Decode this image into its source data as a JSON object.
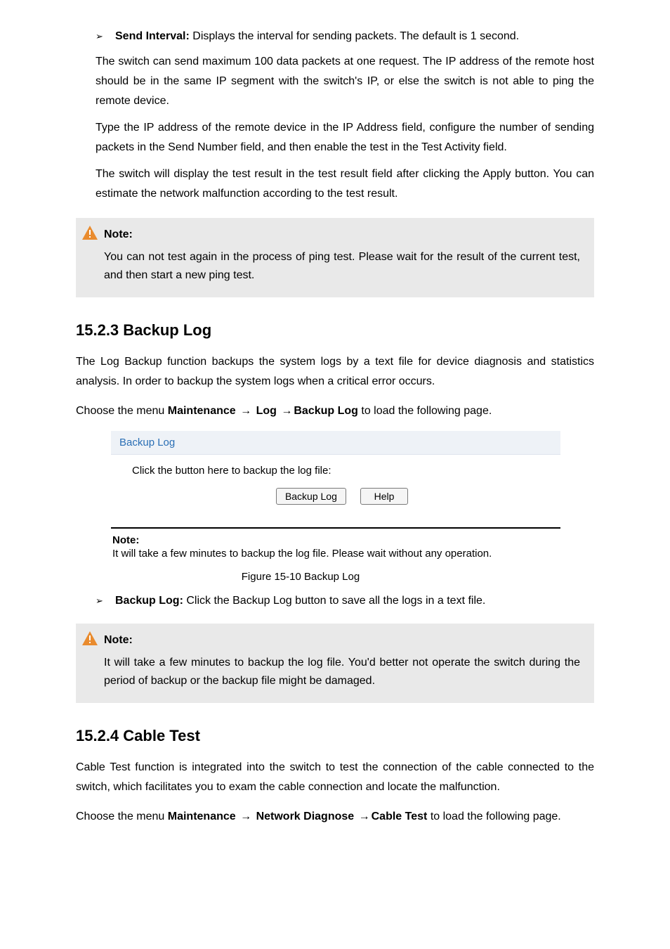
{
  "bullets": {
    "send_interval": {
      "label": "Send Interval:",
      "text": " Displays the interval for sending packets. The default is 1 second."
    },
    "backup_btn": {
      "label": "Backup Log:",
      "text": " Click the Backup Log button to save all the logs in a text file."
    }
  },
  "paras": {
    "p1": "The switch can send maximum 100 data packets at one request. The IP address of the remote host should be in the same IP segment with the switch's IP, or else the switch is not able to ping the remote device.",
    "p2": "Type the IP address of the remote device in the IP Address field, configure the number of sending packets in the Send Number field, and then enable the test in the Test Activity field.",
    "p3": "The switch will display the test result in the test result field after clicking the Apply button. You can estimate the network malfunction according to the test result."
  },
  "alert1": {
    "title": "Note:",
    "body": "You can not test again in the process of ping test. Please wait for the result of the current test, and then start a new ping test."
  },
  "sections": {
    "backup": {
      "heading": "15.2.3 Backup Log",
      "lead": "The Log Backup function backups the system logs by a text file for device diagnosis and statistics analysis. In order to backup the system logs when a critical error occurs.",
      "nav_pre": "Choose the menu ",
      "nav_b1": "Maintenance",
      "nav_b2": "Log",
      "nav_b3": "Backup Log",
      "nav_post": " to load the following page."
    },
    "cable": {
      "heading": "15.2.4 Cable Test",
      "lead": "Cable Test function is integrated into the switch to test the connection of the cable connected to the switch, which facilitates you to exam the cable connection and locate the malfunction.",
      "nav_pre": "Choose the menu ",
      "nav_b1": "Maintenance",
      "nav_b2": "Network Diagnose",
      "nav_b3": "Cable Test",
      "nav_post": " to load the following page."
    }
  },
  "figure": {
    "panel_title": "Backup Log",
    "panel_msg": "Click the button here to backup the log file:",
    "btn_backup": "Backup Log",
    "btn_help": "Help",
    "note_head": "Note:",
    "note_body": "It will take a few minutes to backup the log file. Please wait without any operation.",
    "caption": "Figure 15-10 Backup Log"
  },
  "alert2": {
    "title": "Note:",
    "body": "It will take a few minutes to backup the log file. You'd better not operate the switch during the period of backup or the backup file might be damaged."
  },
  "glyphs": {
    "arrow": "→",
    "tri": "➢"
  }
}
